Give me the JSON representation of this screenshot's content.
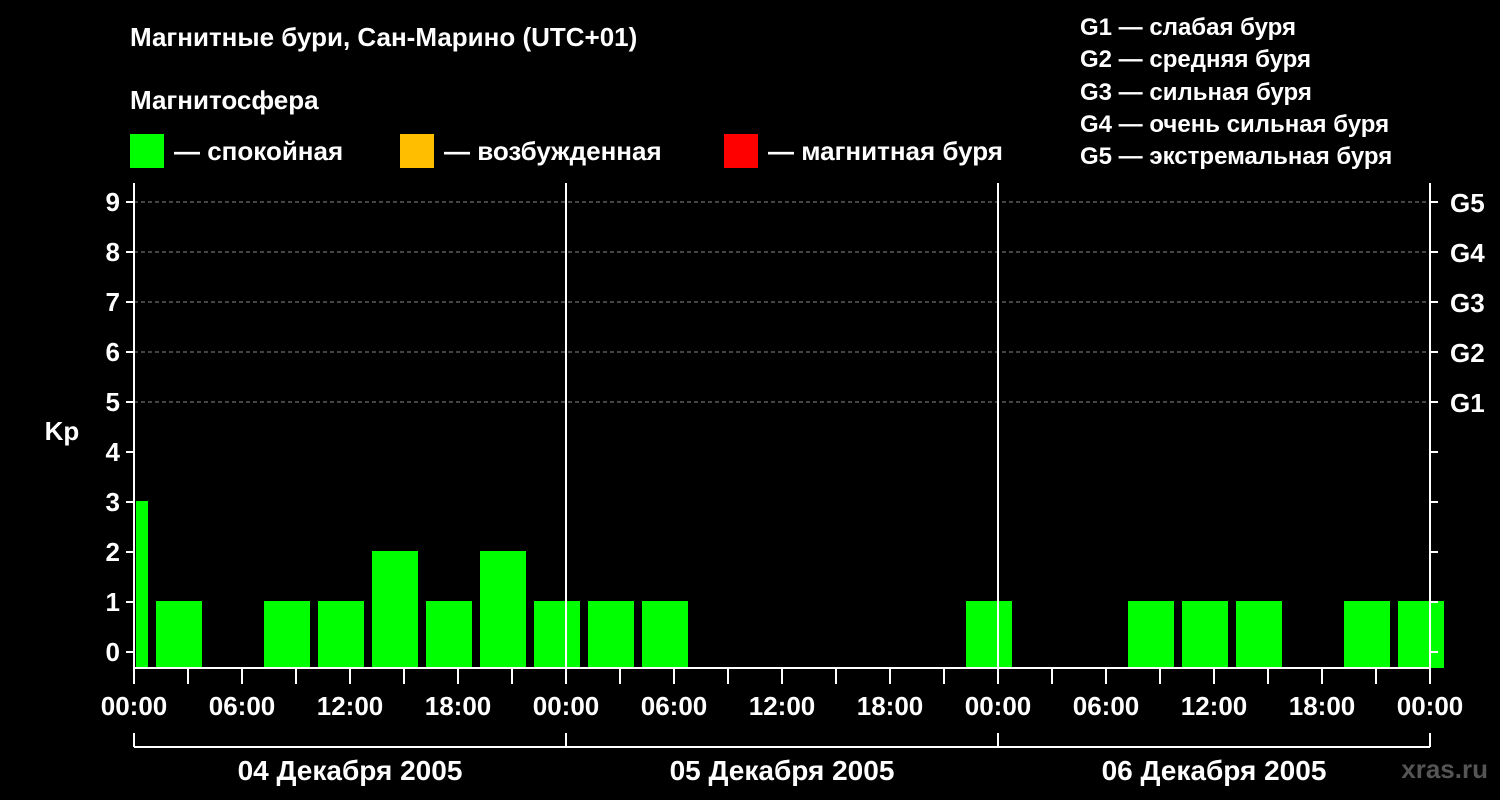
{
  "title": "Магнитные бури, Сан-Марино (UTC+01)",
  "subtitle": "Магнитосфера",
  "legend": [
    {
      "label": "— спокойная",
      "color": "#00ff00"
    },
    {
      "label": "— возбужденная",
      "color": "#ffbf00"
    },
    {
      "label": "— магнитная буря",
      "color": "#ff0000"
    }
  ],
  "storm_levels": [
    "G1 — слабая буря",
    "G2 — средняя буря",
    "G3 — сильная буря",
    "G4 — очень сильная буря",
    "G5 — экстремальная буря"
  ],
  "watermark": "xras.ru",
  "colors": {
    "background": "#000000",
    "quiet": "#00ff00",
    "grid": "#888888",
    "axis": "#ffffff"
  },
  "chart_data": {
    "type": "bar",
    "ylabel": "Kp",
    "ylim": [
      0,
      9
    ],
    "y_ticks": [
      0,
      1,
      2,
      3,
      4,
      5,
      6,
      7,
      8,
      9
    ],
    "right_axis_labels": [
      {
        "kp": 5,
        "label": "G1"
      },
      {
        "kp": 6,
        "label": "G2"
      },
      {
        "kp": 7,
        "label": "G3"
      },
      {
        "kp": 8,
        "label": "G4"
      },
      {
        "kp": 9,
        "label": "G5"
      }
    ],
    "grid": "dashed horizontal at 5–9",
    "x_tick_labels": [
      "00:00",
      "06:00",
      "12:00",
      "18:00",
      "00:00",
      "06:00",
      "12:00",
      "18:00",
      "00:00",
      "06:00",
      "12:00",
      "18:00",
      "00:00"
    ],
    "days": [
      "04 Декабря 2005",
      "05 Декабря 2005",
      "06 Декабря 2005"
    ],
    "interval_hours": 3,
    "first_interval_hours": 1,
    "values": [
      3,
      1,
      0,
      1,
      1,
      2,
      1,
      2,
      1,
      1,
      1,
      0,
      0,
      0,
      0,
      0,
      1,
      0,
      0,
      1,
      1,
      1,
      0,
      1,
      1
    ]
  }
}
